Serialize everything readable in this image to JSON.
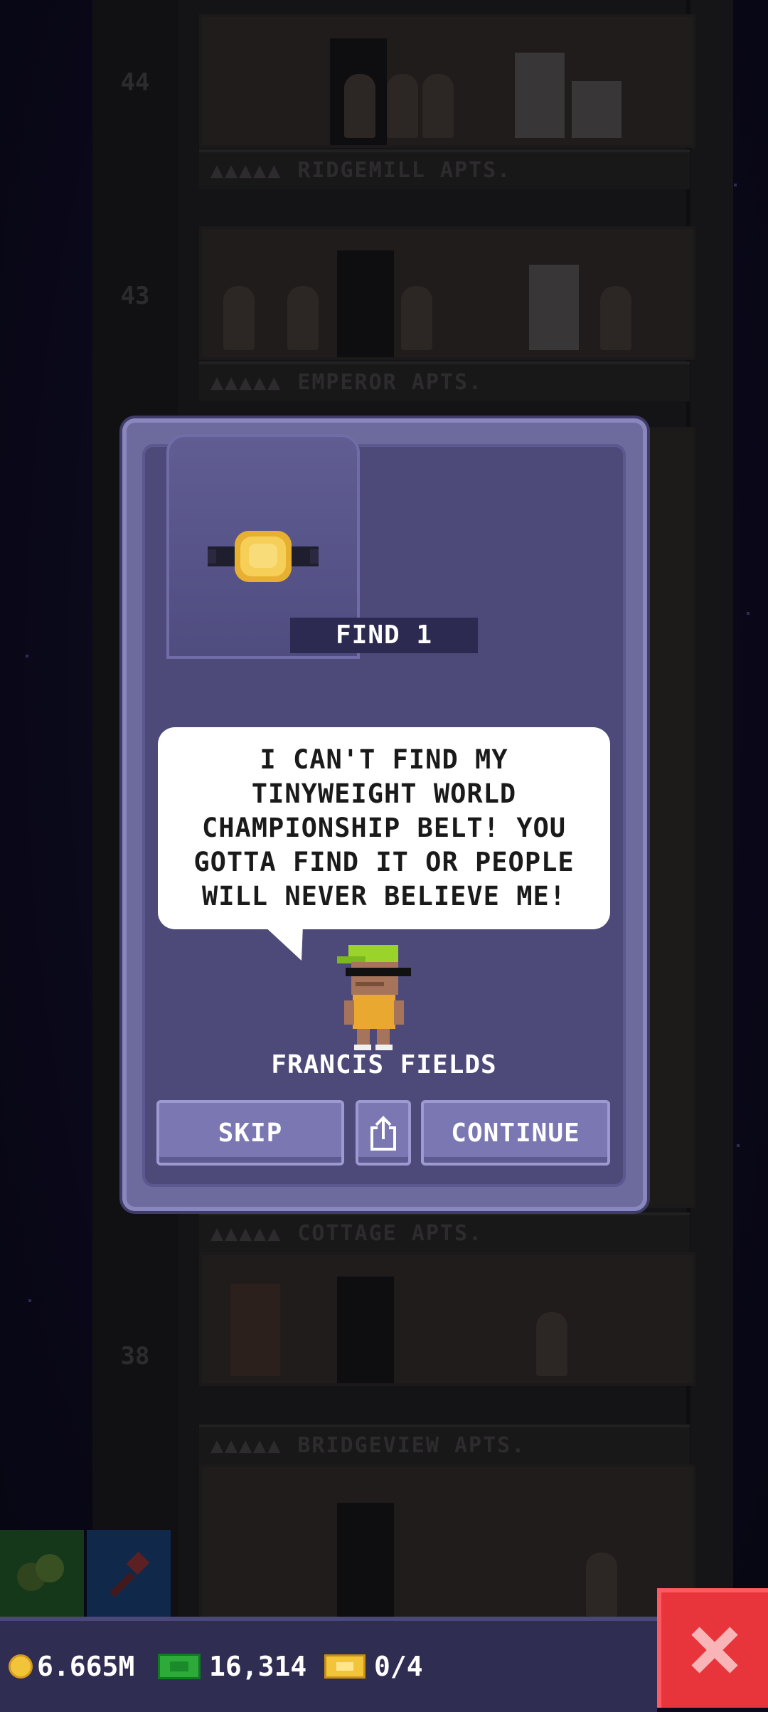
{
  "background": {
    "floor_numbers": [
      "44",
      "43",
      "38"
    ],
    "floor_labels": [
      {
        "stars": "▲▲▲▲▲",
        "name": "RIDGEMILL APTS."
      },
      {
        "stars": "▲▲▲▲▲",
        "name": "EMPEROR APTS."
      },
      {
        "stars": "▲▲▲▲▲",
        "name": "COTTAGE APTS."
      },
      {
        "stars": "▲▲▲▲▲",
        "name": "BRIDGEVIEW APTS."
      }
    ]
  },
  "mission": {
    "item_icon": "championship-belt-icon",
    "find_label": "FIND 1",
    "dialog": "I CAN'T FIND MY\nTINYWEIGHT WORLD\nCHAMPIONSHIP BELT! YOU\nGOTTA FIND IT OR PEOPLE\nWILL NEVER BELIEVE ME!",
    "character_name": "FRANCIS FIELDS"
  },
  "buttons": {
    "skip": "SKIP",
    "share_icon": "share-icon",
    "continue": "CONTINUE"
  },
  "status_bar": {
    "coins": "6.665M",
    "bux": "16,314",
    "tickets": "0/4"
  },
  "colors": {
    "panel": "#6d6a9e",
    "panel_inner": "#4d4a7a",
    "button": "#7a77b2",
    "close": "#e8353b",
    "coin": "#f2c43a",
    "bux": "#2eaa3a"
  }
}
